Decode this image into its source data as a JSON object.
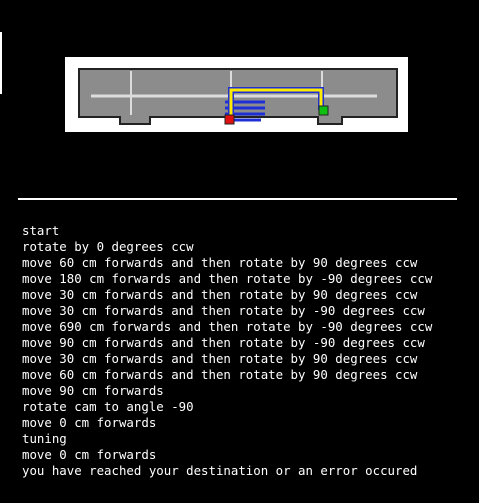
{
  "theme": {
    "background": "#000000",
    "text_color": "#ffffff",
    "map_floor": "#8c8c8c",
    "map_grid_line": "#dcdcdc",
    "path_color": "#ffeb00",
    "path_outline": "#1e2fd6",
    "start_marker": "#e01010",
    "end_marker": "#10c010"
  },
  "map": {
    "icons": [
      "start-marker-icon",
      "end-marker-icon"
    ]
  },
  "log": {
    "lines": [
      "start",
      "rotate by 0 degrees ccw",
      "move 60 cm forwards and then rotate by 90 degrees ccw",
      "move 180 cm forwards and then rotate by -90 degrees ccw",
      "move 30 cm forwards and then rotate by 90 degrees ccw",
      "move 30 cm forwards and then rotate by -90 degrees ccw",
      "move 690 cm forwards and then rotate by -90 degrees ccw",
      "move 90 cm forwards and then rotate by -90 degrees ccw",
      "move 30 cm forwards and then rotate by 90 degrees ccw",
      "move 60 cm forwards and then rotate by 90 degrees ccw",
      "move 90 cm forwards",
      "rotate cam to angle -90",
      "move 0 cm forwards",
      "tuning",
      "move 0 cm forwards",
      "you have reached your destination or an error occured"
    ]
  }
}
